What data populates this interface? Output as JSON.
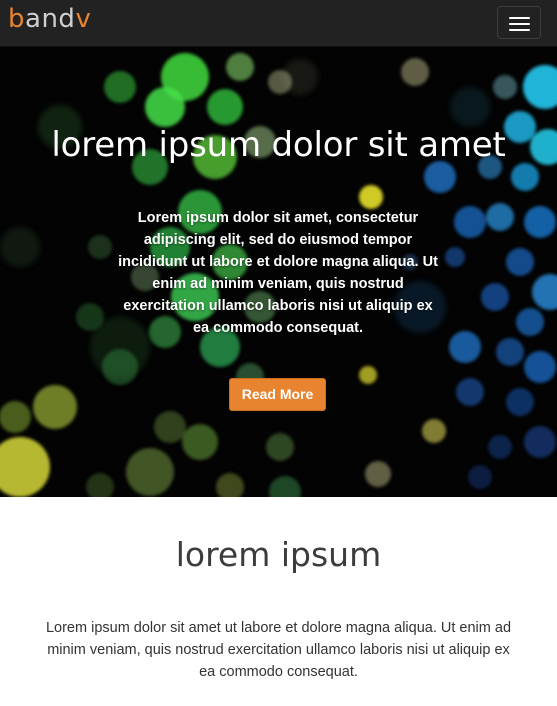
{
  "navbar": {
    "brand_part1": "b",
    "brand_part2": "and",
    "brand_part3": "v",
    "brand_colors": {
      "accent": "#e8842f",
      "light": "#cfcfcf"
    },
    "menu_icon": "hamburger-icon"
  },
  "hero": {
    "title": "lorem ipsum dolor sit amet",
    "text": "Lorem ipsum dolor sit amet, consectetur adipiscing elit, sed do eiusmod tempor incididunt ut labore et dolore magna aliqua. Ut enim ad minim veniam, quis nostrud exercitation ullamco laboris nisi ut aliquip ex ea commodo consequat.",
    "button_label": "Read More",
    "button_color": "#e8842f"
  },
  "section": {
    "title": "lorem ipsum",
    "text": "Lorem ipsum dolor sit amet ut labore et dolore magna aliqua. Ut enim ad minim veniam, quis nostrud exercitation ullamco laboris nisi ut aliquip ex ea commodo consequat."
  }
}
